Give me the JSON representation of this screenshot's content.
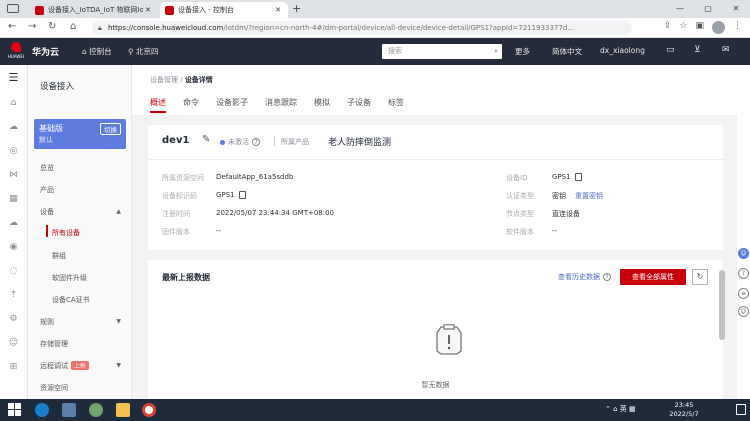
{
  "browser": {
    "tabs": [
      {
        "title": "设备接入_IoTDA_IoT 物联网IoT",
        "close": "✕"
      },
      {
        "title": "设备接入 - 控制台",
        "close": "✕"
      }
    ],
    "new_tab": "+",
    "url_host": "https://console.huaweicloud.com",
    "url_path": "/iotdm/?region=cn-north-4#/dm-portal/device/all-device/device-detail/GPS1?appId=7211933377d..."
  },
  "header": {
    "logo_text": "HUAWEI",
    "brand": "华为云",
    "console": "控制台",
    "region": "北京四",
    "search_placeholder": "搜索",
    "more": "更多",
    "language": "简体中文",
    "user": "dx_xiaolong"
  },
  "sidebar": {
    "title": "设备接入",
    "edition_title": "基础版",
    "edition_sub": "默认",
    "edition_switch": "切换",
    "items": {
      "overview": "总览",
      "product": "产品",
      "device": "设备",
      "all_devices": "所有设备",
      "group": "群组",
      "firmware": "软固件升级",
      "ca_cert": "设备CA证书",
      "rules": "规则",
      "storage": "存储管理",
      "remote_debug": "远程调试",
      "remote_debug_badge": "上新",
      "resource": "资源空间"
    }
  },
  "breadcrumb": {
    "parent": "设备管理",
    "sep": " / ",
    "current": "设备详情"
  },
  "tabs": [
    "概述",
    "命令",
    "设备影子",
    "消息跟踪",
    "模拟",
    "子设备",
    "标签"
  ],
  "device": {
    "name": "dev1",
    "status": "未激活",
    "product_label": "所属产品",
    "product": "老人防摔倒监测",
    "fields_left": [
      {
        "label": "所属资源空间",
        "value": "DefaultApp_61a5sddb"
      },
      {
        "label": "设备标识码",
        "value": "GPS1"
      },
      {
        "label": "注册时间",
        "value": "2022/05/07 23:44:34 GMT+08:00"
      },
      {
        "label": "固件版本",
        "value": "--"
      }
    ],
    "fields_right": [
      {
        "label": "设备ID",
        "value": "GPS1"
      },
      {
        "label": "认证类型",
        "value": "密钥",
        "extra": "重置密钥"
      },
      {
        "label": "节点类型",
        "value": "直连设备"
      },
      {
        "label": "软件版本",
        "value": "--"
      }
    ]
  },
  "report": {
    "title": "最新上报数据",
    "history_link": "查看历史数据",
    "all_props_button": "查看全部属性",
    "empty_text": "暂无数据"
  },
  "taskbar": {
    "ime": "英",
    "time": "23:45",
    "date": "2022/5/7"
  }
}
